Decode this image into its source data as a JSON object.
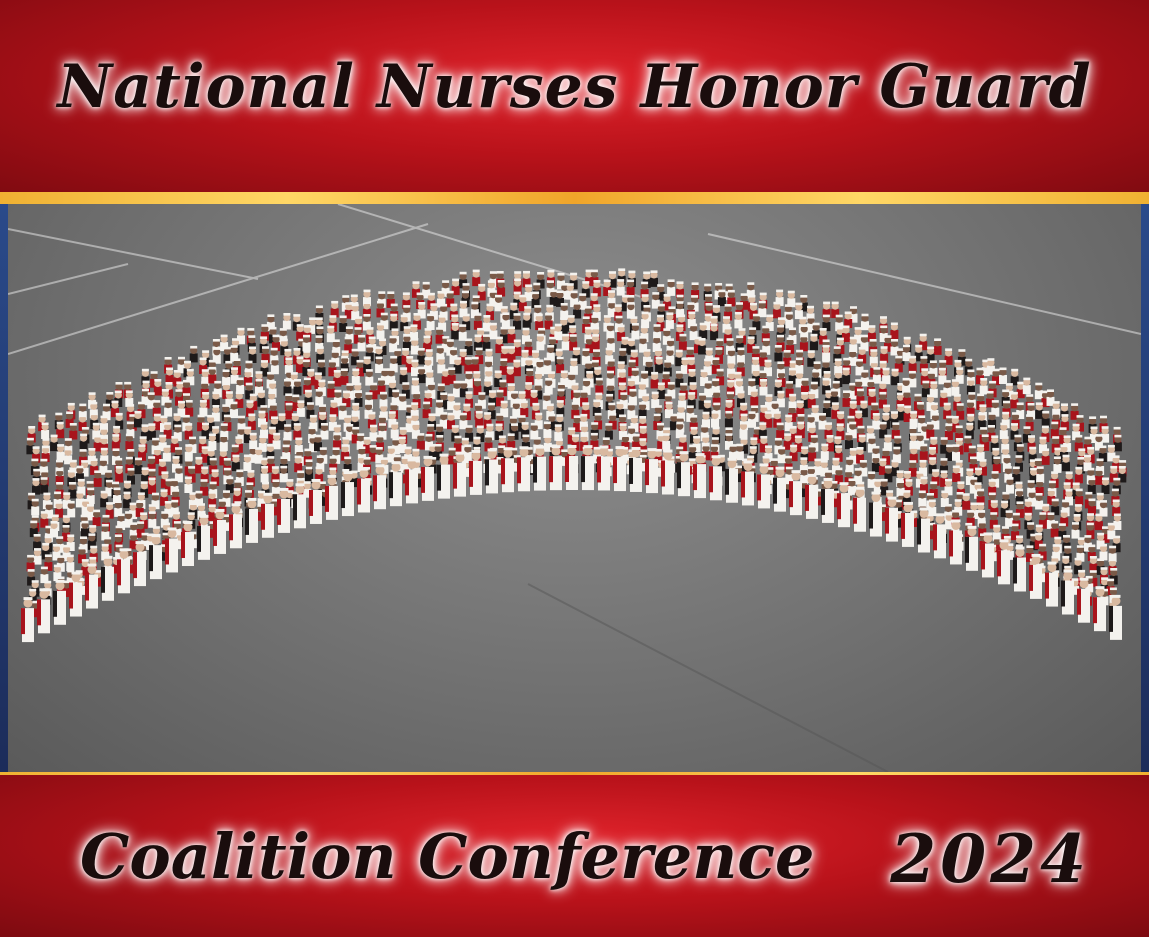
{
  "banner_top": {
    "title": "National Nurses Honor Guard"
  },
  "banner_bottom": {
    "subtitle": "Coalition Conference",
    "year": "2024"
  },
  "photo": {
    "subject": "group-photo-nurses"
  },
  "colors": {
    "banner_red": "#c0141c",
    "gold_trim": "#f0b132",
    "uniform_white": "#f4f2ee",
    "cape_red": "#a8141c",
    "cape_black": "#1e1a1a",
    "pavement": "#777777"
  }
}
